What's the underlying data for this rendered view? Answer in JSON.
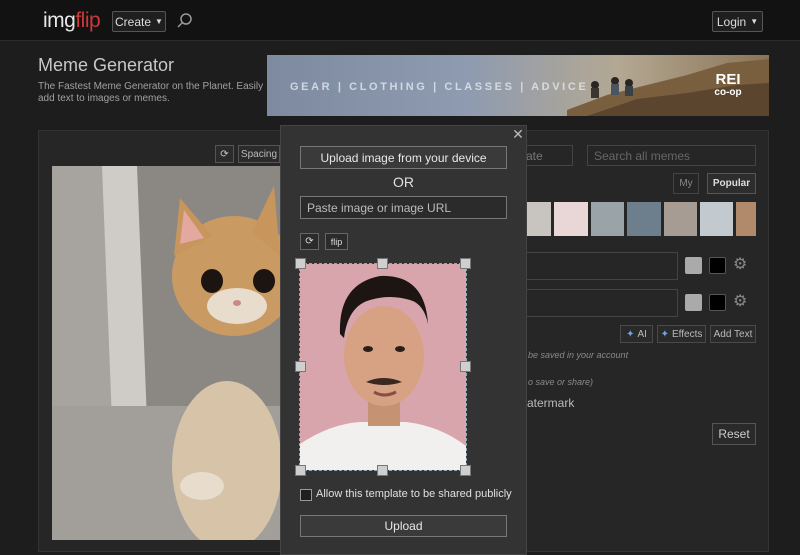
{
  "header": {
    "logo_part1": "img",
    "logo_part2": "flip",
    "create_label": "Create",
    "login_label": "Login"
  },
  "page": {
    "title": "Meme Generator",
    "tagline": "The Fastest Meme Generator on the Planet. Easily add text to images or memes."
  },
  "ad": {
    "text": "GEAR | CLOTHING | CLASSES | ADVICE",
    "logo_line1": "REI",
    "logo_line2": "co‑op"
  },
  "editor": {
    "spacing_label": "Spacing",
    "make_placeholder": "ate",
    "search_placeholder": "Search all memes",
    "tab_my": "My",
    "tab_popular": "Popular",
    "ai_label": "AI",
    "effects_label": "Effects",
    "add_text_label": "Add Text",
    "saved_note": "be saved in your account",
    "save_share_note": "o save or share)",
    "watermark_label": "vatermark",
    "reset_label": "Reset"
  },
  "modal": {
    "upload_device_label": "Upload image from your device",
    "or_label": "OR",
    "url_placeholder": "Paste image or image URL",
    "flip_label": "flip",
    "share_label": "Allow this template to be shared publicly",
    "share_checked": false,
    "upload_label": "Upload"
  },
  "colors": {
    "background": "#1d1d1d",
    "topbar": "#121212",
    "logo_accent": "#c93a3a",
    "modal": "#333333",
    "ai_accent": "#6aa6e8"
  },
  "icons": {
    "search": "search-icon",
    "close": "close-icon",
    "rotate": "rotate-icon",
    "gear": "gear-icon",
    "sparkle": "sparkle-icon"
  }
}
